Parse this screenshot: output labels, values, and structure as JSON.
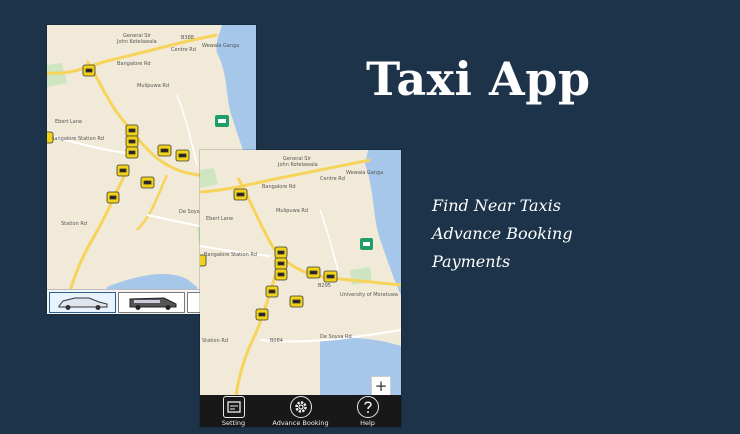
{
  "hero": {
    "title": "Taxi App",
    "features": [
      "Find Near Taxis",
      "Advance Booking",
      "Payments"
    ]
  },
  "map": {
    "labels": [
      "General Sir",
      "John Kotelawala",
      "Centre Rd",
      "Wewala Ganga",
      "Bangalore Rd",
      "Mulipuwa Rd",
      "Ebert Lane",
      "Bangalore Station Rd",
      "Station Rd",
      "De Soysa Rd",
      "University of Moratuwa",
      "B388",
      "B295",
      "B084"
    ],
    "colors": {
      "land": "#f2ead8",
      "water": "#a6c7ea",
      "park": "#cde5c0",
      "road": "#f6d35a",
      "taxi": "#f1d218",
      "marker": "#1f9e6a"
    }
  },
  "vehicle_bar": {
    "items": [
      {
        "icon": "sedan-car-icon",
        "selected": true
      },
      {
        "icon": "van-icon",
        "selected": false
      },
      {
        "icon": "vehicle-tab-icon",
        "selected": false
      }
    ]
  },
  "zoom_label": "+",
  "app_bar": {
    "items": [
      {
        "label": "Setting",
        "icon": "settings-icon"
      },
      {
        "label": "Advance Booking",
        "icon": "gear-icon"
      },
      {
        "label": "Help",
        "icon": "help-icon"
      }
    ]
  }
}
